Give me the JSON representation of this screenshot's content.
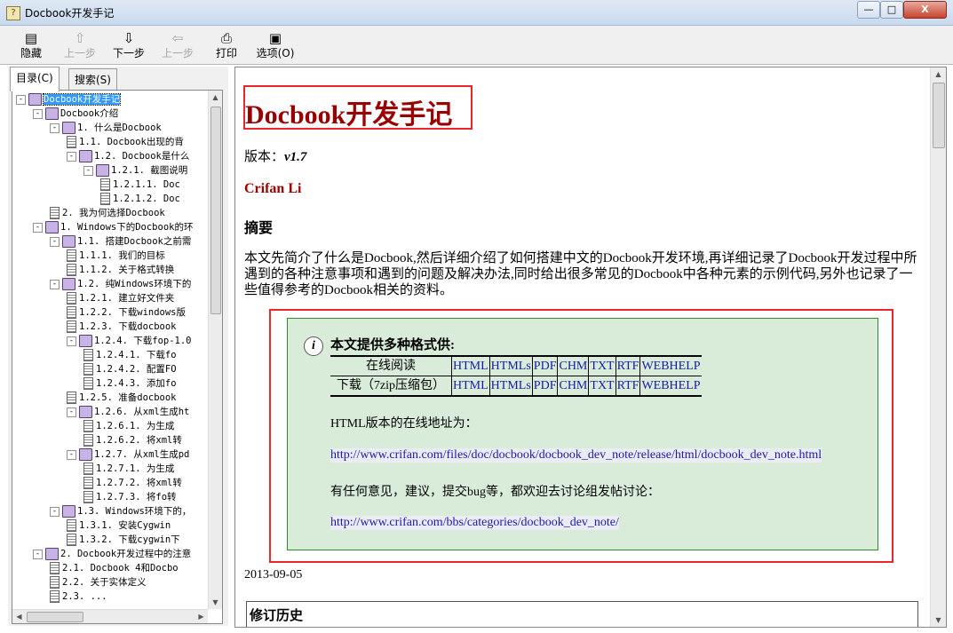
{
  "window": {
    "title": "Docbook开发手记",
    "app_icon": "?",
    "minimize": "—",
    "maximize": "□",
    "close": "X"
  },
  "toolbar": {
    "hide": {
      "label": "隐藏",
      "icon": "hide-icon"
    },
    "back": {
      "label": "上一步",
      "icon": "up-arrow-icon"
    },
    "next": {
      "label": "下一步",
      "icon": "down-arrow-icon"
    },
    "prev": {
      "label": "上一步",
      "icon": "left-arrow-icon"
    },
    "print": {
      "label": "打印",
      "icon": "printer-icon"
    },
    "options": {
      "label": "选项(O)",
      "icon": "options-icon"
    }
  },
  "left": {
    "tab_contents": "目录(C)",
    "tab_search": "搜索(S)",
    "tree": [
      {
        "text": "Docbook开发手记",
        "type": "book",
        "exp": "-",
        "selected": true
      },
      {
        "text": "Docbook介绍",
        "type": "book",
        "exp": "-"
      },
      {
        "text": "1. 什么是Docbook",
        "type": "book",
        "exp": "-"
      },
      {
        "text": "1.1. Docbook出现的背",
        "type": "page"
      },
      {
        "text": "1.2. Docbook是什么",
        "type": "book",
        "exp": "-"
      },
      {
        "text": "1.2.1. 截图说明",
        "type": "book",
        "exp": "-"
      },
      {
        "text": "1.2.1.1. Doc",
        "type": "page"
      },
      {
        "text": "1.2.1.2. Doc",
        "type": "page"
      },
      {
        "text": "2. 我为何选择Docbook",
        "type": "page"
      },
      {
        "text": "1. Windows下的Docbook的环",
        "type": "book",
        "exp": "-"
      },
      {
        "text": "1.1. 搭建Docbook之前需",
        "type": "book",
        "exp": "-"
      },
      {
        "text": "1.1.1. 我们的目标",
        "type": "page"
      },
      {
        "text": "1.1.2. 关于格式转换",
        "type": "page"
      },
      {
        "text": "1.2. 纯Windows环境下的",
        "type": "book",
        "exp": "-"
      },
      {
        "text": "1.2.1. 建立好文件夹",
        "type": "page"
      },
      {
        "text": "1.2.2. 下载windows版",
        "type": "page"
      },
      {
        "text": "1.2.3. 下载docbook",
        "type": "page"
      },
      {
        "text": "1.2.4. 下载fop-1.0",
        "type": "book",
        "exp": "-"
      },
      {
        "text": "1.2.4.1. 下载fo",
        "type": "page"
      },
      {
        "text": "1.2.4.2. 配置FO",
        "type": "page"
      },
      {
        "text": "1.2.4.3. 添加fo",
        "type": "page"
      },
      {
        "text": "1.2.5. 准备docbook",
        "type": "page"
      },
      {
        "text": "1.2.6. 从xml生成ht",
        "type": "book",
        "exp": "-"
      },
      {
        "text": "1.2.6.1. 为生成",
        "type": "page"
      },
      {
        "text": "1.2.6.2. 将xml转",
        "type": "page"
      },
      {
        "text": "1.2.7. 从xml生成pd",
        "type": "book",
        "exp": "-"
      },
      {
        "text": "1.2.7.1. 为生成",
        "type": "page"
      },
      {
        "text": "1.2.7.2. 将xml转",
        "type": "page"
      },
      {
        "text": "1.2.7.3. 将fo转",
        "type": "page"
      },
      {
        "text": "1.3. Windows环境下的，",
        "type": "book",
        "exp": "-"
      },
      {
        "text": "1.3.1. 安装Cygwin",
        "type": "page"
      },
      {
        "text": "1.3.2. 下载cygwin下",
        "type": "page"
      },
      {
        "text": "2. Docbook开发过程中的注意",
        "type": "book",
        "exp": "-"
      },
      {
        "text": "2.1. Docbook 4和Docbo",
        "type": "page"
      },
      {
        "text": "2.2. 关于实体定义",
        "type": "page"
      },
      {
        "text": "2.3. ...",
        "type": "page"
      }
    ],
    "tree_indent_levels": [
      1,
      2,
      3,
      4,
      4,
      5,
      6,
      6,
      3,
      2,
      3,
      4,
      4,
      3,
      4,
      4,
      4,
      4,
      5,
      5,
      5,
      4,
      4,
      5,
      5,
      4,
      5,
      5,
      5,
      3,
      4,
      4,
      2,
      3,
      3,
      3
    ]
  },
  "doc": {
    "title": "Docbook开发手记",
    "version_label": "版本：",
    "version_value": "v1.7",
    "author": "Crifan Li",
    "abstract_heading": "摘要",
    "abstract_text": "本文先简介了什么是Docbook,然后详细介绍了如何搭建中文的Docbook开发环境,再详细记录了Docbook开发过程中所遇到的各种注意事项和遇到的问题及解决办法,同时给出很多常见的Docbook中各种元素的示例代码,另外也记录了一些值得参考的Docbook相关的资料。",
    "info_title": "本文提供多种格式供:",
    "formats_header": [
      "HTML",
      "HTMLs",
      "PDF",
      "CHM",
      "TXT",
      "RTF",
      "WEBHELP"
    ],
    "row_online": "在线阅读",
    "row_download": "下载（7zip压缩包）",
    "html_online_label": "HTML版本的在线地址为：",
    "html_online_url": "http://www.crifan.com/files/doc/docbook/docbook_dev_note/release/html/docbook_dev_note.html",
    "feedback_label": "有任何意见，建议，提交bug等，都欢迎去讨论组发帖讨论：",
    "feedback_url": "http://www.crifan.com/bbs/categories/docbook_dev_note/",
    "date": "2013-09-05",
    "revision_heading": "修订历史"
  }
}
